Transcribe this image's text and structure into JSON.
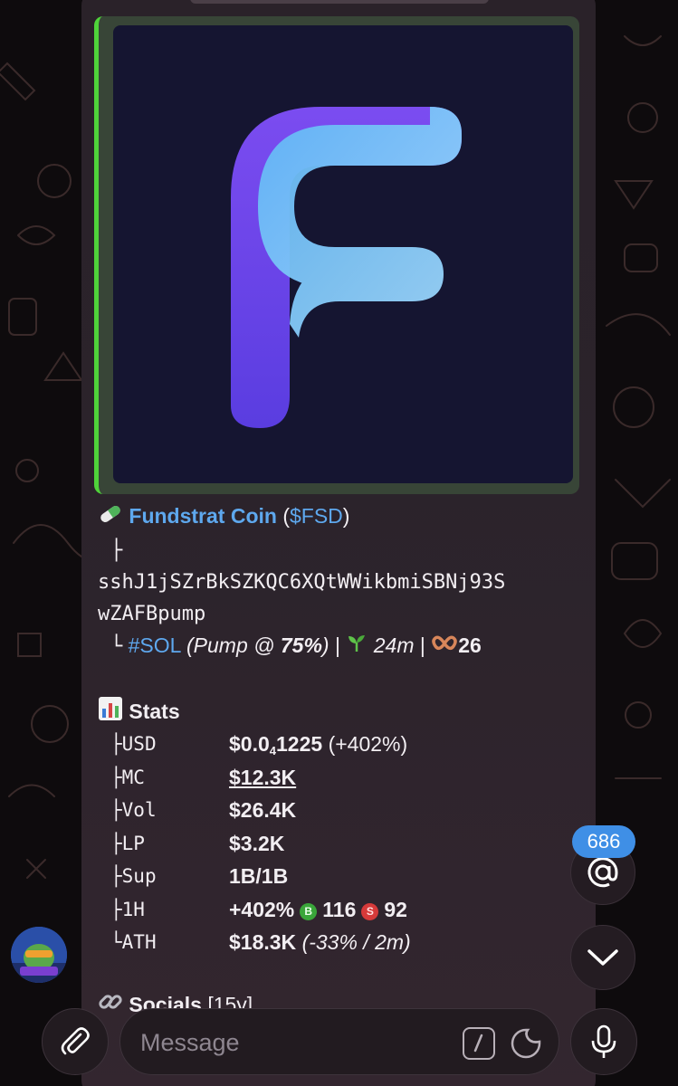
{
  "token": {
    "name": "Fundstrat Coin",
    "ticker": "$FSD",
    "tree_branch": "├",
    "address_line1": "sshJ1jSZrBkSZKQC6XQtWWikbmiSBNj93S",
    "address_line2": "wZAFBpump",
    "tree_end": "└",
    "chain_tag": "#SOL",
    "pump_prefix": "(Pump @ ",
    "pump_pct": "75%",
    "pump_suffix": ")",
    "sep": "|",
    "age": "24m",
    "holders": "26"
  },
  "stats": {
    "heading": "Stats",
    "rows": [
      {
        "branch": "├",
        "key": "USD"
      },
      {
        "branch": "├",
        "key": "MC",
        "value": "$12.3K"
      },
      {
        "branch": "├",
        "key": "Vol",
        "value": "$26.4K"
      },
      {
        "branch": "├",
        "key": "LP",
        "value": "$3.2K"
      },
      {
        "branch": "├",
        "key": "Sup",
        "value": "1B/1B"
      },
      {
        "branch": "├",
        "key": "1H"
      },
      {
        "branch": "└",
        "key": "ATH"
      }
    ],
    "usd_main": "$0.0",
    "usd_sub": "4",
    "usd_rest": "1225",
    "usd_change": "(+402%)",
    "h1_change": "+402%",
    "h1_buy_letter": "B",
    "h1_buys": "116",
    "h1_sell_letter": "S",
    "h1_sells": "92",
    "ath_value": "$18.3K",
    "ath_detail": "(-33% / 2m)"
  },
  "socials": {
    "heading": "Socials",
    "age": "[15y]"
  },
  "mentions_badge": "686",
  "input": {
    "placeholder": "Message"
  },
  "colors": {
    "link": "#5ea8ee",
    "accent_bar": "#4fd33a",
    "badge": "#3f8fe6",
    "buy": "#3aa63a",
    "sell": "#d63a3a"
  }
}
